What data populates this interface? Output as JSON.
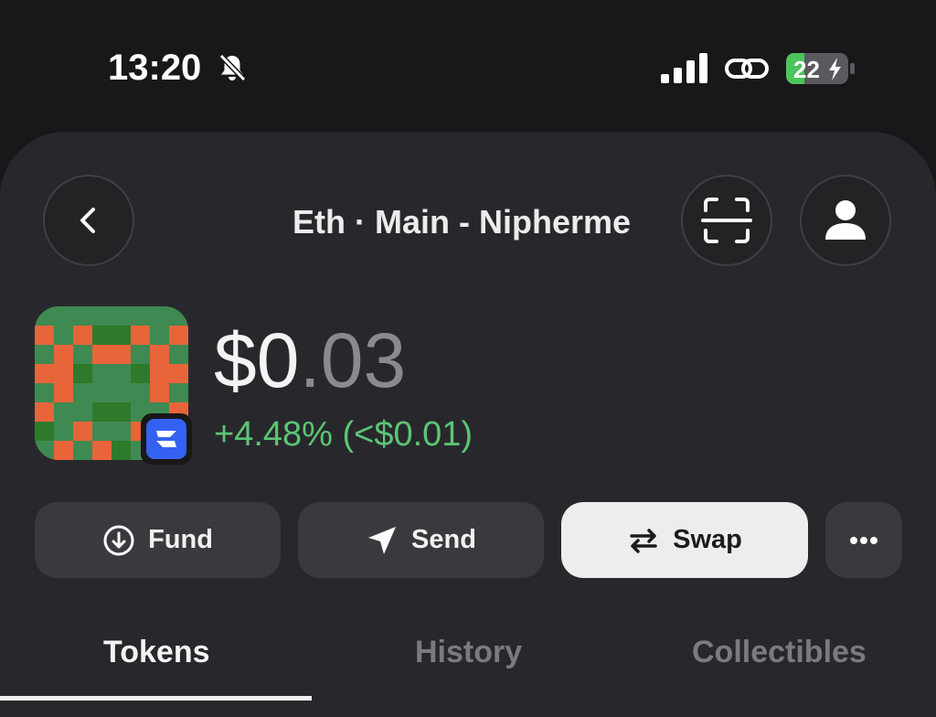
{
  "status_bar": {
    "time": "13:20",
    "battery_level": "22",
    "icons": [
      "bell-slash-icon",
      "signal-icon",
      "link-icon",
      "battery-charging-icon"
    ],
    "battery_color": "#4cc45b"
  },
  "header": {
    "title": "Eth · Main - Nipherme",
    "back_icon": "chevron-left-icon",
    "scan_icon": "scan-icon",
    "profile_icon": "person-icon"
  },
  "wallet": {
    "balance_main": "$0",
    "balance_decimal": ".03",
    "change": "+4.48% (<$0.01)",
    "change_color": "#5cc576",
    "network_badge_icon": "zerion-icon"
  },
  "actions": {
    "fund": "Fund",
    "send": "Send",
    "swap": "Swap",
    "more_icon": "more-dots-icon"
  },
  "tabs": [
    {
      "label": "Tokens",
      "active": true
    },
    {
      "label": "History",
      "active": false
    },
    {
      "label": "Collectibles",
      "active": false
    }
  ]
}
